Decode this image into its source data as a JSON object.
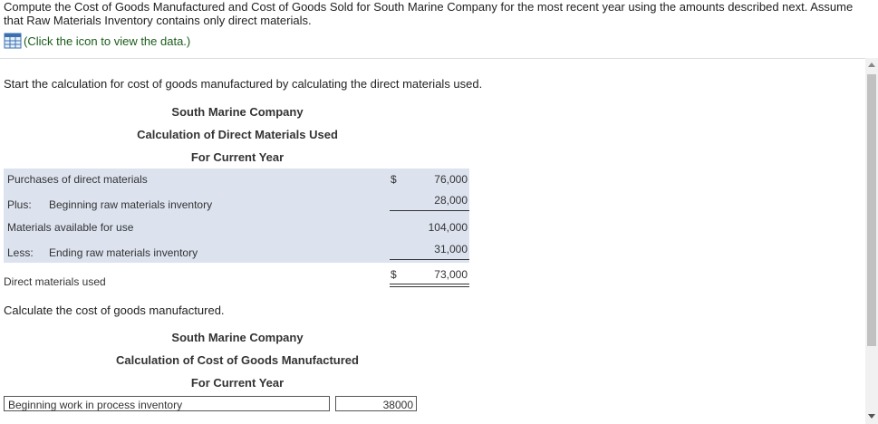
{
  "question": {
    "text": "Compute the Cost of Goods Manufactured and Cost of Goods Sold for South Marine Company for the most recent year using the amounts described next. Assume that Raw Materials Inventory contains only direct materials.",
    "data_link": "(Click the icon to view the data.)"
  },
  "part1": {
    "instruction": "Start the calculation for cost of goods manufactured by calculating the direct materials used.",
    "company": "South Marine Company",
    "title": "Calculation of Direct Materials Used",
    "period": "For Current Year",
    "rows": [
      {
        "prefix": "",
        "label": "Purchases of direct materials",
        "dollar": "$",
        "amount": "76,000"
      },
      {
        "prefix": "Plus:",
        "label": "Beginning raw materials inventory",
        "dollar": "",
        "amount": "28,000"
      },
      {
        "prefix": "",
        "label": "Materials available for use",
        "dollar": "",
        "amount": "104,000"
      },
      {
        "prefix": "Less:",
        "label": "Ending raw materials inventory",
        "dollar": "",
        "amount": "31,000"
      },
      {
        "prefix": "",
        "label": "Direct materials used",
        "dollar": "$",
        "amount": "73,000"
      }
    ]
  },
  "part2": {
    "instruction": "Calculate the cost of goods manufactured.",
    "company": "South Marine Company",
    "title": "Calculation of Cost of Goods Manufactured",
    "period": "For Current Year",
    "rows": [
      {
        "label": "Beginning work in process inventory",
        "amount": "38000"
      }
    ]
  }
}
